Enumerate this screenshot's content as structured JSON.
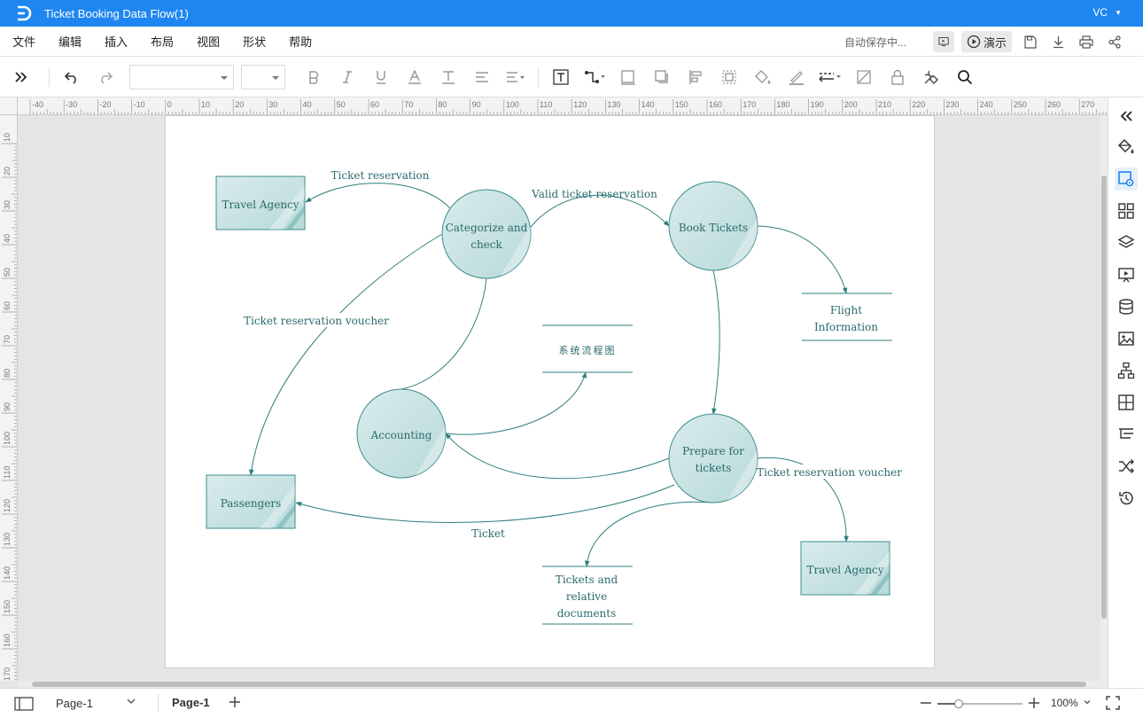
{
  "app": {
    "title": "Ticket Booking Data Flow(1)",
    "user": "VC"
  },
  "menu": {
    "items": [
      "文件",
      "编辑",
      "插入",
      "布局",
      "视图",
      "形状",
      "帮助"
    ],
    "autosave": "自动保存中...",
    "present_label": "演示"
  },
  "ruler": {
    "h_ticks": [
      "-40",
      "-30",
      "-20",
      "-10",
      "0",
      "10",
      "20",
      "30",
      "40",
      "50",
      "60",
      "70",
      "80",
      "90",
      "100",
      "110",
      "120",
      "130",
      "140",
      "150",
      "160",
      "170",
      "180",
      "190",
      "200",
      "210",
      "220",
      "230",
      "240",
      "250",
      "260",
      "270"
    ],
    "v_ticks": [
      "10",
      "20",
      "30",
      "40",
      "50",
      "60",
      "70",
      "80",
      "90",
      "100",
      "110",
      "120",
      "130",
      "140",
      "150",
      "160",
      "170"
    ]
  },
  "diagram": {
    "entities": {
      "travel_agency_1": "Travel Agency",
      "passengers": "Passengers",
      "travel_agency_2": "Travel Agency"
    },
    "processes": {
      "categorize": [
        "Categorize and",
        "check"
      ],
      "book": "Book Tickets",
      "accounting": "Accounting",
      "prepare": [
        "Prepare for",
        "tickets"
      ]
    },
    "stores": {
      "flight": [
        "Flight",
        "Information"
      ],
      "system": "系统流程图",
      "tickets_docs": [
        "Tickets and",
        "relative",
        "documents"
      ]
    },
    "flows": {
      "ticket_reservation": "Ticket reservation",
      "valid_ticket_reservation": "Valid ticket reservation",
      "voucher_left": "Ticket reservation voucher",
      "voucher_right": "Ticket reservation voucher",
      "ticket": "Ticket"
    }
  },
  "statusbar": {
    "page_selector": "Page-1",
    "page_tab": "Page-1",
    "zoom": "100%"
  },
  "colors": {
    "title_bar": "#1e86f0",
    "shape_fill": "#c9e3e3",
    "shape_stroke": "#3d8d8d",
    "connector": "#2f7e7e"
  }
}
